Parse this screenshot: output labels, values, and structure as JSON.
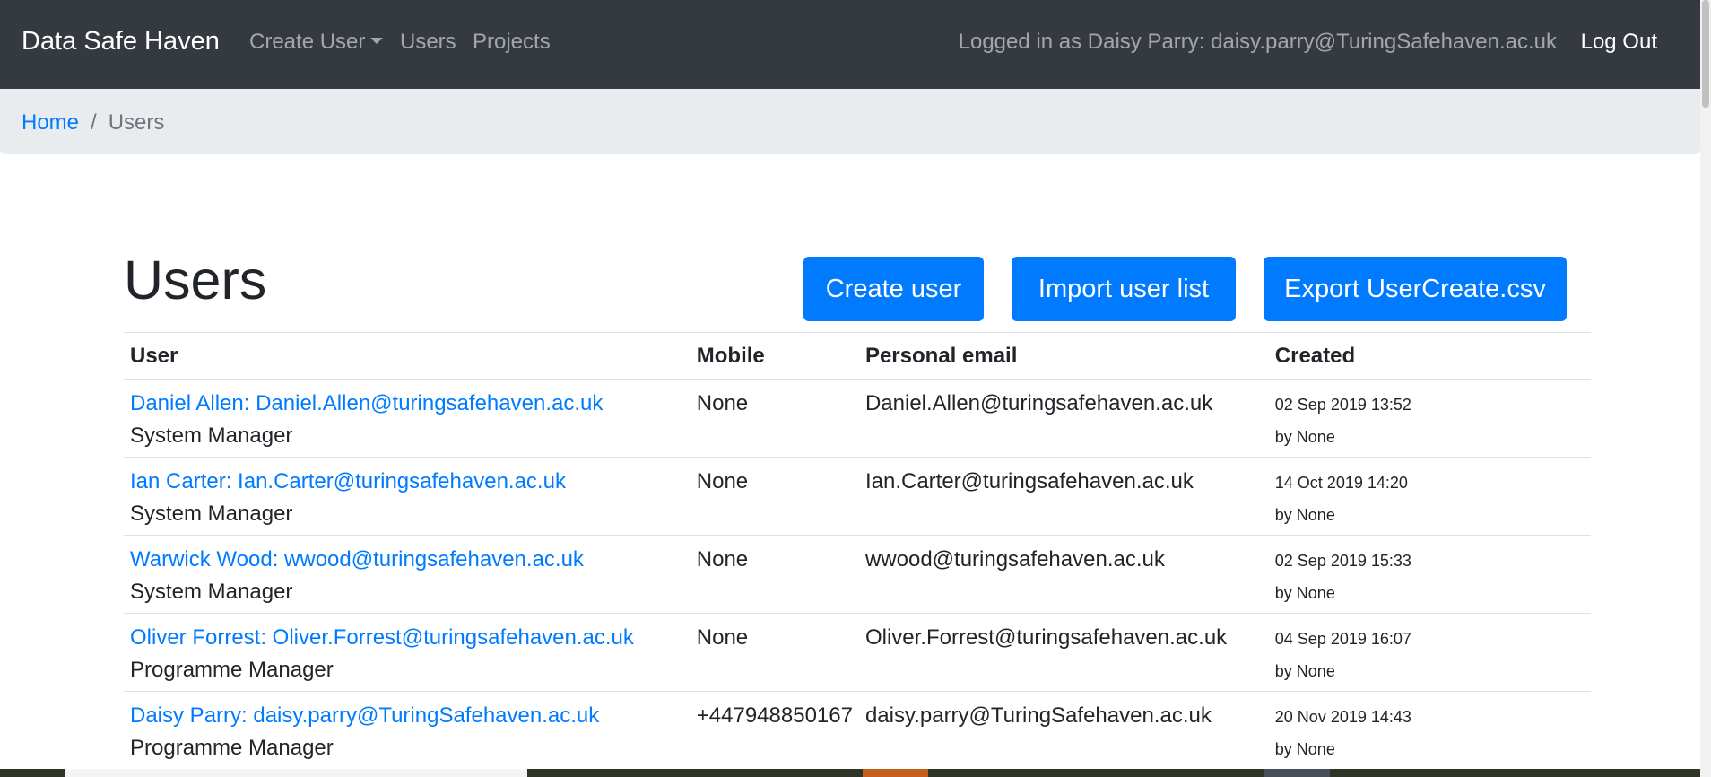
{
  "navbar": {
    "brand": "Data Safe Haven",
    "links": {
      "create_user": "Create User",
      "users": "Users",
      "projects": "Projects"
    },
    "logged_in_text": "Logged in as Daisy Parry: daisy.parry@TuringSafehaven.ac.uk",
    "logout": "Log Out"
  },
  "breadcrumb": {
    "home": "Home",
    "separator": "/",
    "current": "Users"
  },
  "page": {
    "title": "Users",
    "buttons": {
      "create_user": "Create user",
      "import_user_list": "Import user list",
      "export": "Export UserCreate.csv"
    }
  },
  "table": {
    "headers": {
      "user": "User",
      "mobile": "Mobile",
      "personal_email": "Personal email",
      "created": "Created"
    },
    "rows": [
      {
        "user": "Daniel Allen: Daniel.Allen@turingsafehaven.ac.uk",
        "role": "System Manager",
        "mobile": "None",
        "email": "Daniel.Allen@turingsafehaven.ac.uk",
        "created": "02 Sep 2019 13:52",
        "by": "by None"
      },
      {
        "user": "Ian Carter: Ian.Carter@turingsafehaven.ac.uk",
        "role": "System Manager",
        "mobile": "None",
        "email": "Ian.Carter@turingsafehaven.ac.uk",
        "created": "14 Oct 2019 14:20",
        "by": "by None"
      },
      {
        "user": "Warwick Wood: wwood@turingsafehaven.ac.uk",
        "role": "System Manager",
        "mobile": "None",
        "email": "wwood@turingsafehaven.ac.uk",
        "created": "02 Sep 2019 15:33",
        "by": "by None"
      },
      {
        "user": "Oliver Forrest: Oliver.Forrest@turingsafehaven.ac.uk",
        "role": "Programme Manager",
        "mobile": "None",
        "email": "Oliver.Forrest@turingsafehaven.ac.uk",
        "created": "04 Sep 2019 16:07",
        "by": "by None"
      },
      {
        "user": "Daisy Parry: daisy.parry@TuringSafehaven.ac.uk",
        "role": "Programme Manager",
        "mobile": "+447948850167",
        "email": "daisy.parry@TuringSafehaven.ac.uk",
        "created": "20 Nov 2019 14:43",
        "by": "by None"
      }
    ]
  },
  "colors": {
    "navbar_bg": "#343a40",
    "primary": "#007bff",
    "breadcrumb_bg": "#e9ecef",
    "muted": "#6c757d"
  }
}
